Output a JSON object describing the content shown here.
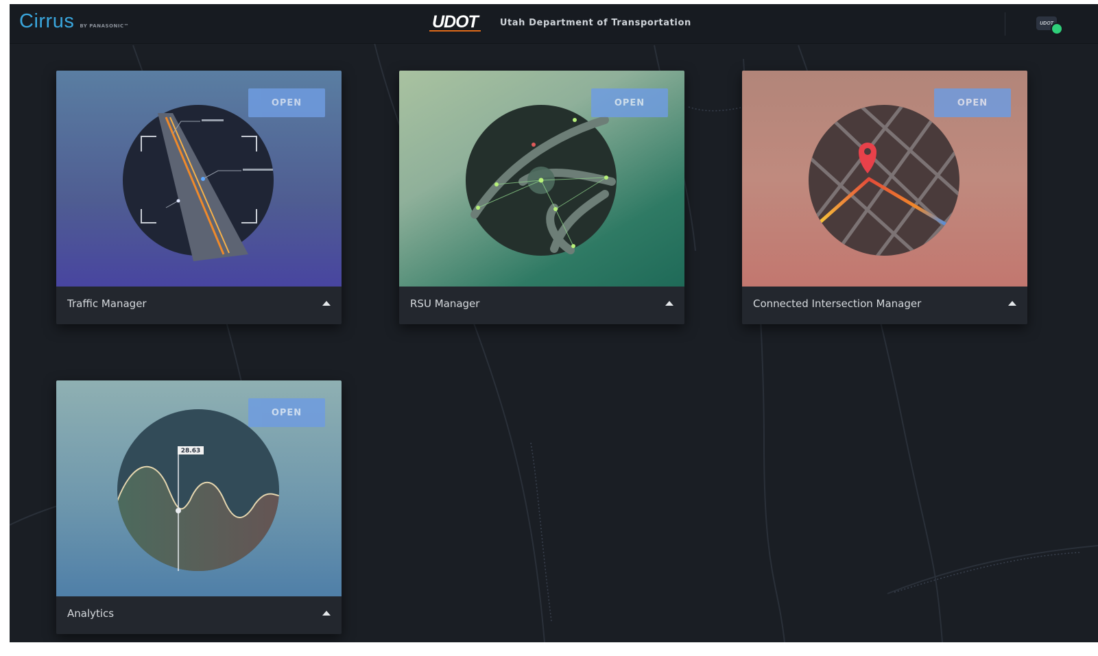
{
  "header": {
    "brand": "Cirrus",
    "brand_sub": "BY PANASONIC™",
    "logo": "UDOT",
    "department": "Utah Department of Transportation",
    "avatar_label": "UDOT",
    "status_color": "#2fd07a"
  },
  "cards": [
    {
      "title": "Traffic Manager",
      "button": "OPEN",
      "icon": "highway-radar-icon"
    },
    {
      "title": "RSU Manager",
      "button": "OPEN",
      "icon": "rsu-network-map-icon"
    },
    {
      "title": "Connected Intersection Manager",
      "button": "OPEN",
      "icon": "intersection-map-pin-icon"
    },
    {
      "title": "Analytics",
      "button": "OPEN",
      "icon": "analytics-wave-chart-icon",
      "chart_label": "28.63"
    }
  ],
  "colors": {
    "accent": "#3aa6dd",
    "open_button": "#6f9ce0",
    "background": "#1a1e24"
  }
}
